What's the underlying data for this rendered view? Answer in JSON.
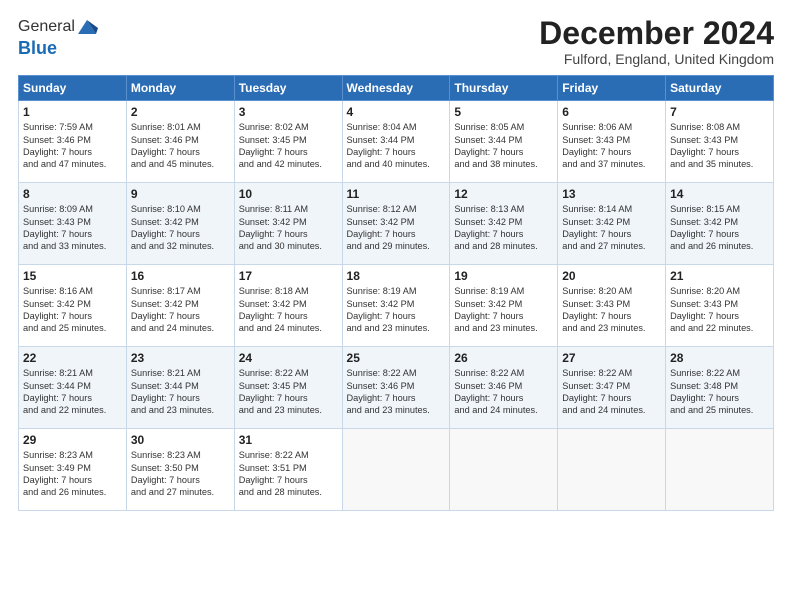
{
  "logo": {
    "general": "General",
    "blue": "Blue"
  },
  "title": "December 2024",
  "location": "Fulford, England, United Kingdom",
  "days_of_week": [
    "Sunday",
    "Monday",
    "Tuesday",
    "Wednesday",
    "Thursday",
    "Friday",
    "Saturday"
  ],
  "weeks": [
    [
      {
        "day": "1",
        "sunrise": "Sunrise: 7:59 AM",
        "sunset": "Sunset: 3:46 PM",
        "daylight": "Daylight: 7 hours and 47 minutes."
      },
      {
        "day": "2",
        "sunrise": "Sunrise: 8:01 AM",
        "sunset": "Sunset: 3:46 PM",
        "daylight": "Daylight: 7 hours and 45 minutes."
      },
      {
        "day": "3",
        "sunrise": "Sunrise: 8:02 AM",
        "sunset": "Sunset: 3:45 PM",
        "daylight": "Daylight: 7 hours and 42 minutes."
      },
      {
        "day": "4",
        "sunrise": "Sunrise: 8:04 AM",
        "sunset": "Sunset: 3:44 PM",
        "daylight": "Daylight: 7 hours and 40 minutes."
      },
      {
        "day": "5",
        "sunrise": "Sunrise: 8:05 AM",
        "sunset": "Sunset: 3:44 PM",
        "daylight": "Daylight: 7 hours and 38 minutes."
      },
      {
        "day": "6",
        "sunrise": "Sunrise: 8:06 AM",
        "sunset": "Sunset: 3:43 PM",
        "daylight": "Daylight: 7 hours and 37 minutes."
      },
      {
        "day": "7",
        "sunrise": "Sunrise: 8:08 AM",
        "sunset": "Sunset: 3:43 PM",
        "daylight": "Daylight: 7 hours and 35 minutes."
      }
    ],
    [
      {
        "day": "8",
        "sunrise": "Sunrise: 8:09 AM",
        "sunset": "Sunset: 3:43 PM",
        "daylight": "Daylight: 7 hours and 33 minutes."
      },
      {
        "day": "9",
        "sunrise": "Sunrise: 8:10 AM",
        "sunset": "Sunset: 3:42 PM",
        "daylight": "Daylight: 7 hours and 32 minutes."
      },
      {
        "day": "10",
        "sunrise": "Sunrise: 8:11 AM",
        "sunset": "Sunset: 3:42 PM",
        "daylight": "Daylight: 7 hours and 30 minutes."
      },
      {
        "day": "11",
        "sunrise": "Sunrise: 8:12 AM",
        "sunset": "Sunset: 3:42 PM",
        "daylight": "Daylight: 7 hours and 29 minutes."
      },
      {
        "day": "12",
        "sunrise": "Sunrise: 8:13 AM",
        "sunset": "Sunset: 3:42 PM",
        "daylight": "Daylight: 7 hours and 28 minutes."
      },
      {
        "day": "13",
        "sunrise": "Sunrise: 8:14 AM",
        "sunset": "Sunset: 3:42 PM",
        "daylight": "Daylight: 7 hours and 27 minutes."
      },
      {
        "day": "14",
        "sunrise": "Sunrise: 8:15 AM",
        "sunset": "Sunset: 3:42 PM",
        "daylight": "Daylight: 7 hours and 26 minutes."
      }
    ],
    [
      {
        "day": "15",
        "sunrise": "Sunrise: 8:16 AM",
        "sunset": "Sunset: 3:42 PM",
        "daylight": "Daylight: 7 hours and 25 minutes."
      },
      {
        "day": "16",
        "sunrise": "Sunrise: 8:17 AM",
        "sunset": "Sunset: 3:42 PM",
        "daylight": "Daylight: 7 hours and 24 minutes."
      },
      {
        "day": "17",
        "sunrise": "Sunrise: 8:18 AM",
        "sunset": "Sunset: 3:42 PM",
        "daylight": "Daylight: 7 hours and 24 minutes."
      },
      {
        "day": "18",
        "sunrise": "Sunrise: 8:19 AM",
        "sunset": "Sunset: 3:42 PM",
        "daylight": "Daylight: 7 hours and 23 minutes."
      },
      {
        "day": "19",
        "sunrise": "Sunrise: 8:19 AM",
        "sunset": "Sunset: 3:42 PM",
        "daylight": "Daylight: 7 hours and 23 minutes."
      },
      {
        "day": "20",
        "sunrise": "Sunrise: 8:20 AM",
        "sunset": "Sunset: 3:43 PM",
        "daylight": "Daylight: 7 hours and 23 minutes."
      },
      {
        "day": "21",
        "sunrise": "Sunrise: 8:20 AM",
        "sunset": "Sunset: 3:43 PM",
        "daylight": "Daylight: 7 hours and 22 minutes."
      }
    ],
    [
      {
        "day": "22",
        "sunrise": "Sunrise: 8:21 AM",
        "sunset": "Sunset: 3:44 PM",
        "daylight": "Daylight: 7 hours and 22 minutes."
      },
      {
        "day": "23",
        "sunrise": "Sunrise: 8:21 AM",
        "sunset": "Sunset: 3:44 PM",
        "daylight": "Daylight: 7 hours and 23 minutes."
      },
      {
        "day": "24",
        "sunrise": "Sunrise: 8:22 AM",
        "sunset": "Sunset: 3:45 PM",
        "daylight": "Daylight: 7 hours and 23 minutes."
      },
      {
        "day": "25",
        "sunrise": "Sunrise: 8:22 AM",
        "sunset": "Sunset: 3:46 PM",
        "daylight": "Daylight: 7 hours and 23 minutes."
      },
      {
        "day": "26",
        "sunrise": "Sunrise: 8:22 AM",
        "sunset": "Sunset: 3:46 PM",
        "daylight": "Daylight: 7 hours and 24 minutes."
      },
      {
        "day": "27",
        "sunrise": "Sunrise: 8:22 AM",
        "sunset": "Sunset: 3:47 PM",
        "daylight": "Daylight: 7 hours and 24 minutes."
      },
      {
        "day": "28",
        "sunrise": "Sunrise: 8:22 AM",
        "sunset": "Sunset: 3:48 PM",
        "daylight": "Daylight: 7 hours and 25 minutes."
      }
    ],
    [
      {
        "day": "29",
        "sunrise": "Sunrise: 8:23 AM",
        "sunset": "Sunset: 3:49 PM",
        "daylight": "Daylight: 7 hours and 26 minutes."
      },
      {
        "day": "30",
        "sunrise": "Sunrise: 8:23 AM",
        "sunset": "Sunset: 3:50 PM",
        "daylight": "Daylight: 7 hours and 27 minutes."
      },
      {
        "day": "31",
        "sunrise": "Sunrise: 8:22 AM",
        "sunset": "Sunset: 3:51 PM",
        "daylight": "Daylight: 7 hours and 28 minutes."
      },
      null,
      null,
      null,
      null
    ]
  ]
}
